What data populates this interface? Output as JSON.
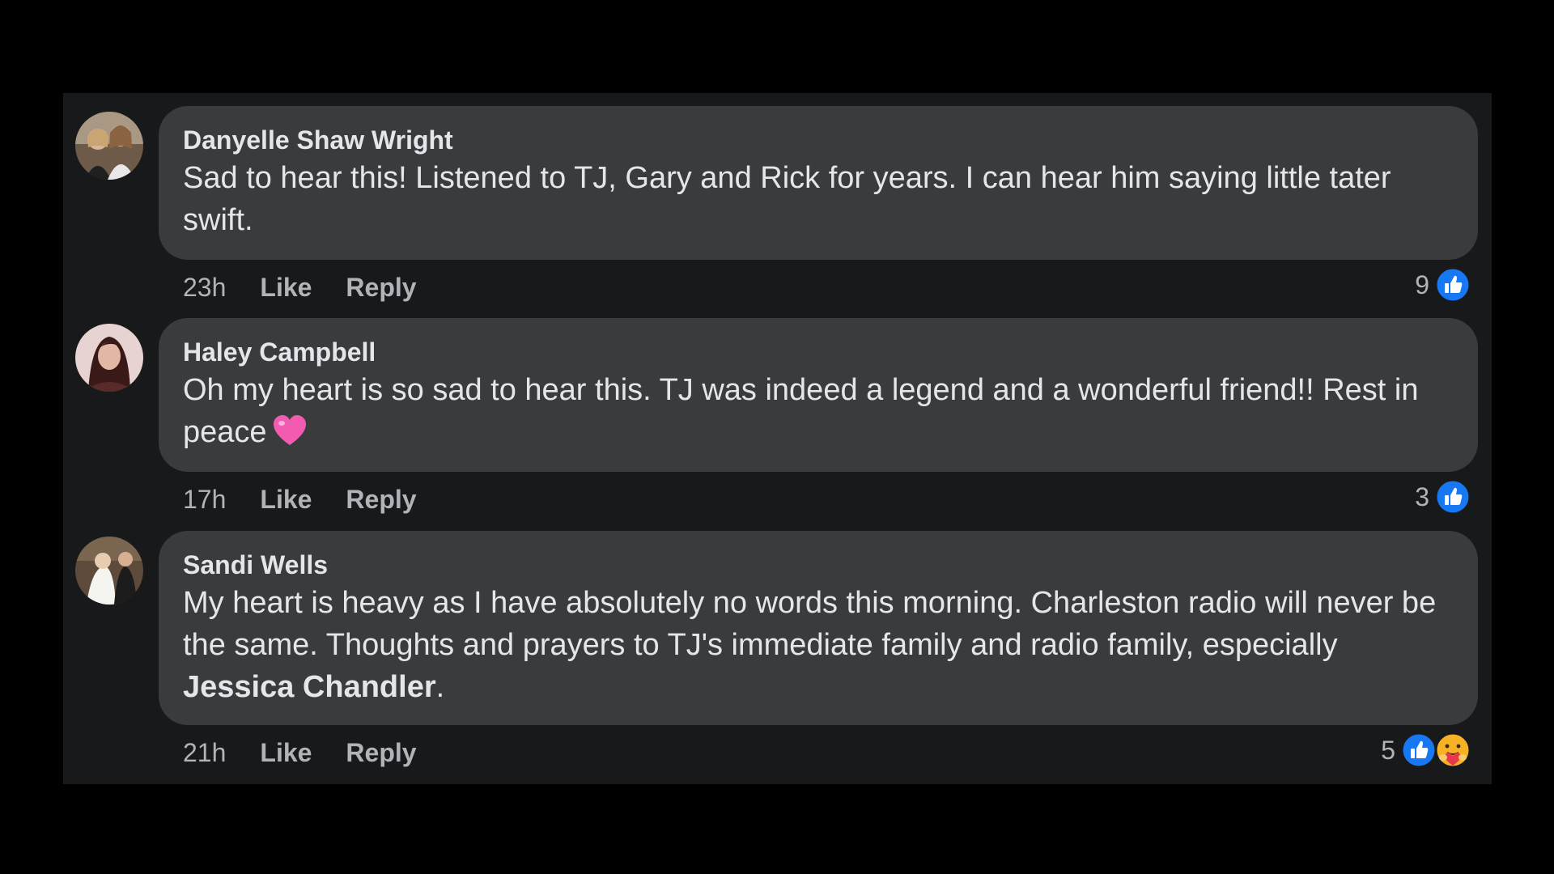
{
  "comments": [
    {
      "author": "Danyelle Shaw Wright",
      "text": "Sad to hear this! Listened to TJ, Gary and Rick for years. I can hear him saying little tater swift.",
      "time": "23h",
      "like_label": "Like",
      "reply_label": "Reply",
      "reaction_count": "9",
      "reactions": [
        "like-icon"
      ]
    },
    {
      "author": "Haley Campbell",
      "text": "Oh my heart is so sad to hear this. TJ was indeed a legend and a wonderful friend!! Rest in peace",
      "emoji": "pink-heart-emoji",
      "time": "17h",
      "like_label": "Like",
      "reply_label": "Reply",
      "reaction_count": "3",
      "reactions": [
        "like-icon"
      ]
    },
    {
      "author": "Sandi Wells",
      "text_before_mention": "My heart is heavy as I have absolutely no words this morning. Charleston radio will never be the same. Thoughts and prayers to TJ's immediate family and radio family, especially ",
      "mention": "Jessica Chandler",
      "text_after_mention": ".",
      "time": "21h",
      "like_label": "Like",
      "reply_label": "Reply",
      "reaction_count": "5",
      "reactions": [
        "like-icon",
        "care-icon"
      ]
    }
  ],
  "colors": {
    "background": "#000000",
    "panel": "#18191a",
    "bubble": "#3a3b3c",
    "primary_text": "#e4e6eb",
    "secondary_text": "#b0b3b8",
    "like_blue": "#1877f2",
    "heart_pink": "#f35bb0"
  }
}
